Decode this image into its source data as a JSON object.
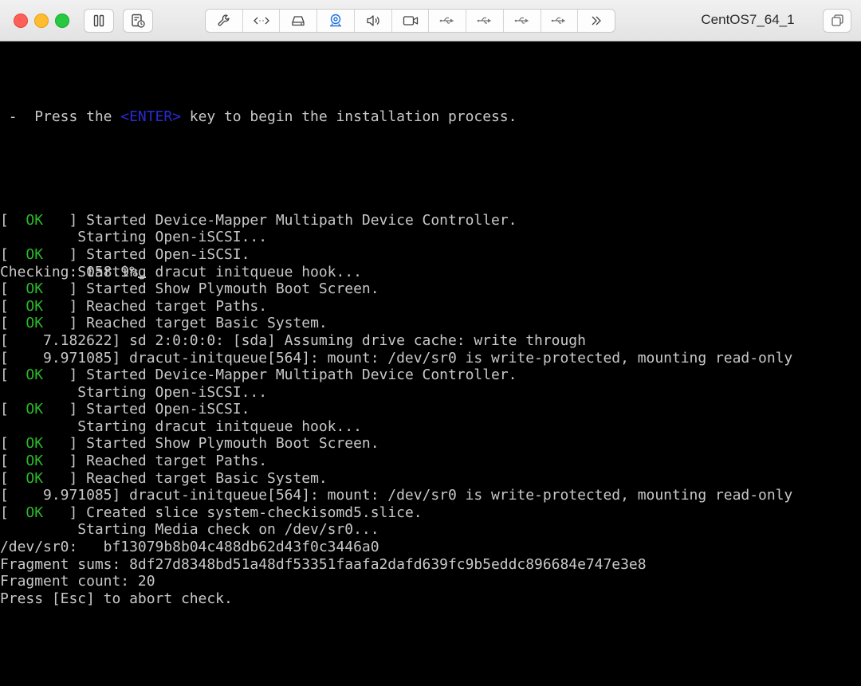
{
  "window": {
    "title": "CentOS7_64_1"
  },
  "toolbar": {
    "icons": [
      "pause-icon",
      "snapshot-icon",
      "wrench-icon",
      "code-icon",
      "disk-icon",
      "camera-icon",
      "sound-icon",
      "video-icon",
      "usb-icon",
      "usb-icon",
      "usb-icon",
      "usb-icon",
      "more-icon",
      "fullscreen-icon"
    ]
  },
  "console": {
    "prompt": {
      "pre": " -  Press the ",
      "key": "<ENTER>",
      "post": " key to begin the installation process."
    },
    "lines": [
      {
        "ok": true,
        "text": " ] Started Device-Mapper Multipath Device Controller."
      },
      {
        "ok": false,
        "text": "         Starting Open-iSCSI..."
      },
      {
        "ok": true,
        "text": " ] Started Open-iSCSI."
      },
      {
        "ok": false,
        "text": "         Starting dracut initqueue hook..."
      },
      {
        "ok": true,
        "text": " ] Started Show Plymouth Boot Screen."
      },
      {
        "ok": true,
        "text": " ] Reached target Paths."
      },
      {
        "ok": true,
        "text": " ] Reached target Basic System."
      },
      {
        "ok": false,
        "text": "[    7.182622] sd 2:0:0:0: [sda] Assuming drive cache: write through"
      },
      {
        "ok": false,
        "text": "[    9.971085] dracut-initqueue[564]: mount: /dev/sr0 is write-protected, mounting read-only"
      },
      {
        "ok": true,
        "text": " ] Started Device-Mapper Multipath Device Controller."
      },
      {
        "ok": false,
        "text": "         Starting Open-iSCSI..."
      },
      {
        "ok": true,
        "text": " ] Started Open-iSCSI."
      },
      {
        "ok": false,
        "text": "         Starting dracut initqueue hook..."
      },
      {
        "ok": true,
        "text": " ] Started Show Plymouth Boot Screen."
      },
      {
        "ok": true,
        "text": " ] Reached target Paths."
      },
      {
        "ok": true,
        "text": " ] Reached target Basic System."
      },
      {
        "ok": false,
        "text": "[    9.971085] dracut-initqueue[564]: mount: /dev/sr0 is write-protected, mounting read-only"
      },
      {
        "ok": true,
        "text": " ] Created slice system-checkisomd5.slice."
      },
      {
        "ok": false,
        "text": "         Starting Media check on /dev/sr0..."
      },
      {
        "ok": false,
        "text": "/dev/sr0:   bf13079b8b04c488db62d43f0c3446a0"
      },
      {
        "ok": false,
        "text": "Fragment sums: 8df27d8348bd51a48df53351faafa2dafd639fc9b5eddc896684e747e3e8"
      },
      {
        "ok": false,
        "text": "Fragment count: 20"
      },
      {
        "ok": false,
        "text": "Press [Esc] to abort check."
      }
    ],
    "ok_prefix_open": "[  ",
    "ok_label": "OK",
    "ok_prefix_close": "  ",
    "progress": "Checking: 058.9%"
  },
  "colors": {
    "ok": "#2ab82a",
    "key": "#2a2ad6",
    "text": "#c8c8c8",
    "background": "#000000"
  }
}
